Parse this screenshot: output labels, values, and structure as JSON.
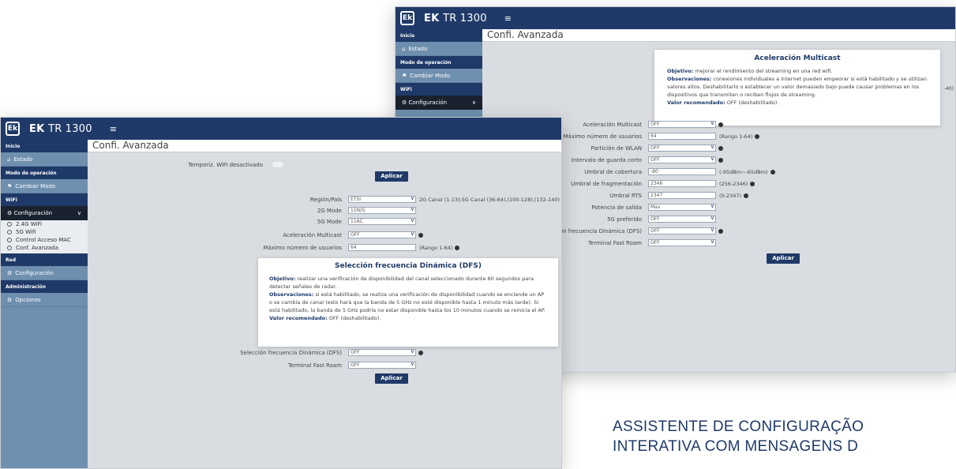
{
  "back": {
    "logo": "Ek",
    "brand": "EK",
    "brand_num": "TR 1300",
    "menu_icon": "≡",
    "title": "Confi. Avanzada",
    "sidebar": {
      "inicio": "Inicio",
      "estado": "Estado",
      "modo_head": "Modo de operación",
      "cambiar": "Cambiar Modo",
      "wifi_head": "WiFi",
      "config": "Configuración"
    },
    "popup": {
      "title": "Aceleración Multicast",
      "objetivo_label": "Objetivo:",
      "objetivo": " mejorar el rendimiento del streaming en una red wifi.",
      "obs_label": "Observaciones:",
      "obs": " conexiones individuales a Internet pueden empeorar si está habilitado y se utilizan valores altos. Deshabilitarlo o establecer un valor demasiado bajo puede causar problemas en los dispositivos que transmiten o reciben flujos de streaming.",
      "valor_label": "Valor recomendado:",
      "valor": " OFF (deshabilitado)."
    },
    "side_hint": "-40)",
    "rows": [
      {
        "label": "Aceleración Multicast",
        "value": "OFF",
        "hint": ""
      },
      {
        "label": "Máximo número de usuarios",
        "value": "64",
        "hint": "(Rango 1-64)"
      },
      {
        "label": "Partición de WLAN",
        "value": "OFF",
        "hint": ""
      },
      {
        "label": "Intervalo de guarda corto",
        "value": "OFF",
        "hint": ""
      },
      {
        "label": "Umbral de cobertura",
        "value": "-90",
        "hint": "(-95dBm~-65dBm)"
      },
      {
        "label": "Umbral de fragmentación",
        "value": "2346",
        "hint": "(256-2346)"
      },
      {
        "label": "Umbral RTS",
        "value": "2347",
        "hint": "(0-2347)"
      },
      {
        "label": "Potencia de salida",
        "value": "Max",
        "hint": ""
      },
      {
        "label": "5G preferido",
        "value": "OFF",
        "hint": ""
      },
      {
        "label": "Selección frecuencia Dinámica (DFS)",
        "value": "OFF",
        "hint": ""
      },
      {
        "label": "Terminal Fast Roam",
        "value": "OFF",
        "hint": ""
      }
    ],
    "apply": "Aplicar"
  },
  "front": {
    "logo": "Ek",
    "brand": "EK",
    "brand_num": "TR 1300",
    "menu_icon": "≡",
    "title": "Confi. Avanzada",
    "sidebar": {
      "inicio": "Inicio",
      "estado": "Estado",
      "modo_head": "Modo de operación",
      "cambiar": "Cambiar Modo",
      "wifi_head": "WiFi",
      "config": "Configuración",
      "sub": [
        "2.4G WiFi",
        "5G Wifi",
        "Control Acceso MAC",
        "Conf. Avanzada"
      ],
      "red_head": "Red",
      "config2": "Configuración",
      "admin_head": "Administración",
      "opciones": "Opciones"
    },
    "temporiz": "Temporiz. WiFi desactivado",
    "apply": "Aplicar",
    "rows": [
      {
        "label": "Región/País",
        "value": "ETSI",
        "hint": "2G Canal (1-13);5G Canal (36-64),(100-128),(132-140)"
      },
      {
        "label": "2G Mode",
        "value": "11N/G",
        "hint": ""
      },
      {
        "label": "5G Mode",
        "value": "11AC",
        "hint": ""
      },
      {
        "label": "Aceleración Multicast",
        "value": "OFF",
        "hint": ""
      },
      {
        "label": "Máximo número de usuarios",
        "value": "64",
        "hint": "(Rango 1-64)"
      }
    ],
    "popup": {
      "title": "Selección frecuencia Dinámica (DFS)",
      "objetivo_label": "Objetivo:",
      "objetivo": " realizar una verificación de disponibilidad del canal seleccionado durante 60 segundos para detectar señales de radar.",
      "obs_label": "Observaciones:",
      "obs": " si está habilitado, se realiza una verificación de disponibilidad cuando se enciende un AP o se cambia de canal (esto hará que la banda de 5 GHz no esté disponible hasta 1 minuto más tarde). Si está habilitado, la banda de 5 GHz podría no estar disponible hasta los 10 minutos cuando se reinicia el AP.",
      "valor_label": "Valor recomendado:",
      "valor": " OFF (deshabilitado)."
    },
    "rows_bottom": [
      {
        "label": "Selección frecuencia Dinámica (DFS)",
        "value": "OFF"
      },
      {
        "label": "Terminal Fast Roam",
        "value": "OFF"
      }
    ]
  },
  "caption": {
    "line1": "ASSISTENTE DE CONFIGURAÇÃO",
    "line2": "INTERATIVA COM MENSAGENS D"
  }
}
